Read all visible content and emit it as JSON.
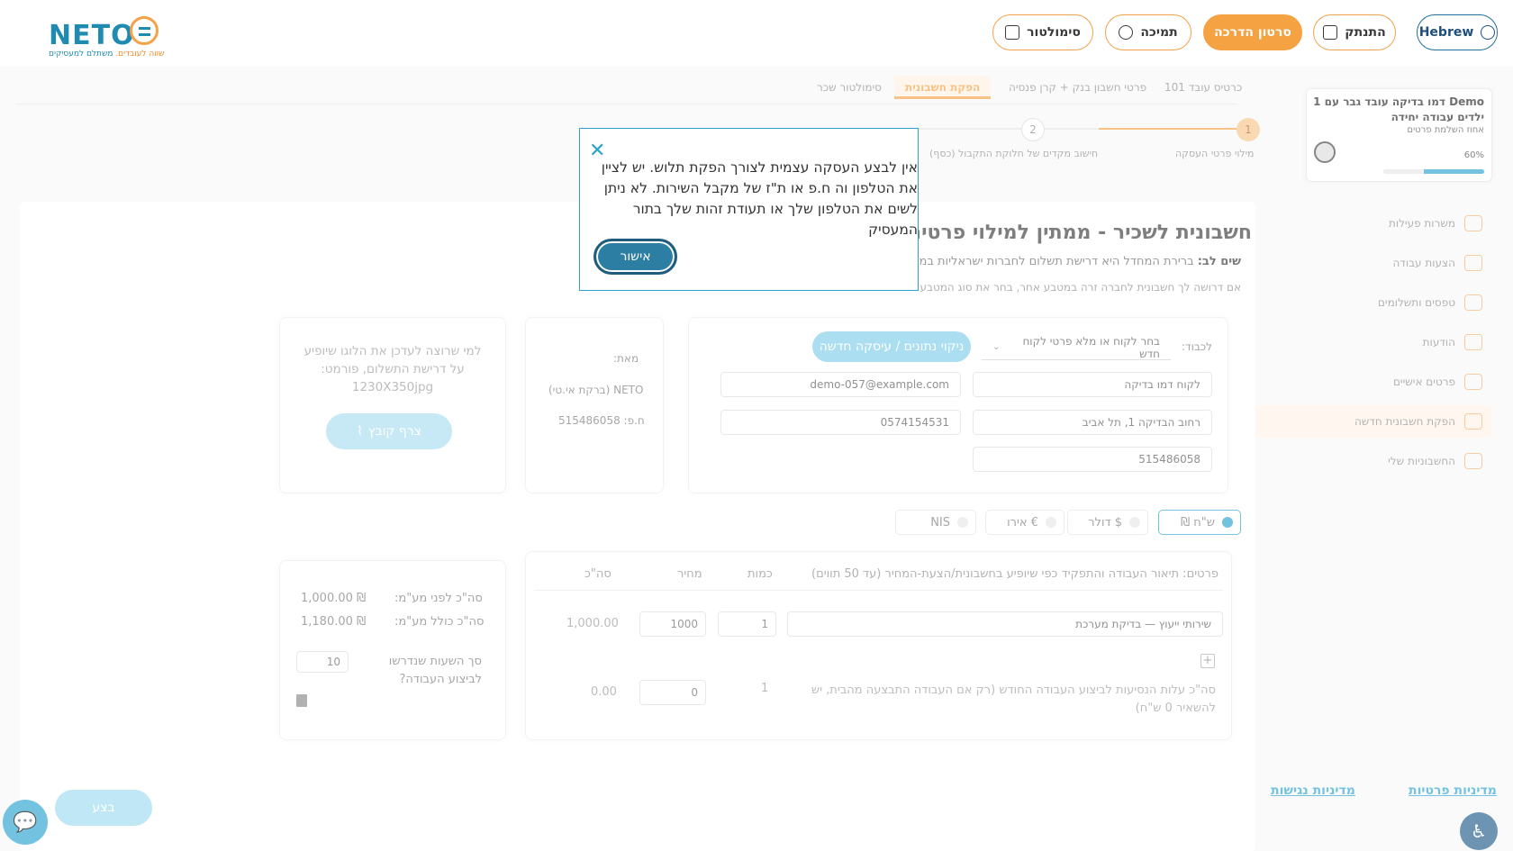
{
  "header": {
    "logo_text": "NETO",
    "logo_tagline_a": "משתלם למעסיקים",
    "logo_tagline_b": "שווה לעובדים.",
    "language_btn": "Hebrew",
    "logout_btn": "התנתק",
    "tutorial_btn": "סרטון הדרכה",
    "support_btn": "תמיכה",
    "simulator_btn": "סימולטור"
  },
  "sidebar": {
    "demo_card": {
      "title": "Demo דמו בדיקה עובד גבר עם 1 ילדים עבודה יחידה",
      "subtitle": "אחוז השלמת פרטים",
      "percent_label": "60%",
      "progress": 0.6
    },
    "items": [
      {
        "label": "משרות פעילות"
      },
      {
        "label": "הצעות עבודה"
      },
      {
        "label": "טפסים ותשלומים"
      },
      {
        "label": "הודעות"
      },
      {
        "label": "פרטים אישיים"
      },
      {
        "label": "הפקת חשבונית חדשה"
      },
      {
        "label": "החשבוניות שלי"
      }
    ],
    "privacy_link": "מדיניות פרטיות",
    "accessibility_link": "מדיניות נגישות"
  },
  "tabs": [
    {
      "label": "כרטיס עובד 101"
    },
    {
      "label": "פרטי חשבון בנק + קרן פנסיה"
    },
    {
      "label": "הפקת חשבונית"
    },
    {
      "label": "סימולטור שכר"
    }
  ],
  "steps": [
    {
      "num": "1",
      "label": "מילוי פרטי העסקה"
    },
    {
      "num": "2",
      "label": "חישוב מקדים של חלוקת התקבול (כסף)"
    }
  ],
  "main": {
    "title": "חשבונית לשכיר - ממתין למילוי פרטים",
    "note_bold": "שים לב:",
    "note_text": "ברירת המחדל היא דרישת תשלום לחברות ישראליות במטבע",
    "note2": "אם דרושה לך חשבונית לחברה זרה במטבע אחר, בחר את סוג המטבע",
    "to_label": "לכבוד:",
    "customer_select": "בחר לקוח או מלא פרטי לקוח חדש",
    "clear_btn": "ניקוי נתונים / עיסקה חדשה",
    "customer_name": "לקוח דמו בדיקה",
    "customer_email": "demo-057@example.com",
    "customer_address": "רחוב הבדיקה 1, תל אביב",
    "customer_phone": "0574154531",
    "customer_id": "515486058",
    "from_label": "מאת:",
    "from_name": "NETO (ברקת אי.טי)",
    "from_id": "ח.פ: 515486058",
    "logo_hint": "למי שרוצה לעדכן את הלוגו שיופיע על דרישת התשלום, פורמט: 1230X350jpg",
    "attach_btn": "צרף קובץ",
    "currencies": [
      {
        "label": "ש\"ח ₪"
      },
      {
        "label": "$ דולר"
      },
      {
        "label": "€ אירו"
      },
      {
        "label": "NIS"
      }
    ],
    "table": {
      "headers": [
        "פרטים: תיאור העבודה והתפקיד כפי שיופיע בחשבונית/הצעת-המחיר (עד 50 תווים)",
        "כמות",
        "מחיר",
        "סה\"כ"
      ],
      "row": {
        "description": "שירותי ייעוץ — בדיקת מערכת",
        "quantity": "1",
        "price": "1000",
        "total": "1,000.00"
      },
      "travel_label": "סה\"כ עלות הנסיעות לביצוע העבודה החודש (רק אם העבודה התבצעה מהבית, יש להשאיר 0 ש\"ח)",
      "travel_qty": "1",
      "travel_price": "0",
      "travel_total": "0.00"
    },
    "summary": {
      "before_vat_label": "סה\"כ לפני מע\"מ:",
      "before_vat": "₪ 1,000.00",
      "with_vat_label": "סה\"כ כולל מע\"מ:",
      "with_vat": "₪ 1,180.00",
      "hours_label": "סך השעות שנדרשו לביצוע העבודה?",
      "hours_value": "10"
    },
    "submit_btn": "בצע"
  },
  "modal": {
    "text": "אין לבצע העסקה עצמית לצורך הפקת תלוש. יש לציין את הטלפון וה ח.פ או ת\"ז של מקבל השירות. לא ניתן לשים את הטלפון שלך או תעודת זהות שלך בתור המעסיק",
    "ok_btn": "אישור"
  },
  "colors": {
    "accent_orange": "#f5a242",
    "accent_blue": "#29a3cf",
    "brand_dark": "#1f5c8a"
  }
}
